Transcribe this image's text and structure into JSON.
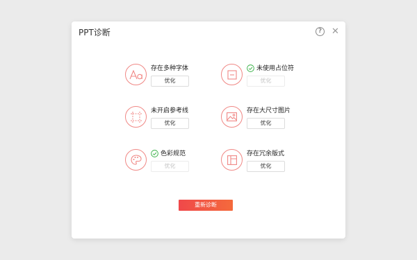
{
  "dialog": {
    "title": "PPT诊断",
    "help_symbol": "?",
    "close_symbol": "✕"
  },
  "items": [
    {
      "label": "存在多种字体",
      "button": "优化",
      "resolved": false,
      "icon": "font-icon"
    },
    {
      "label": "未使用占位符",
      "button": "优化",
      "resolved": true,
      "icon": "placeholder-icon"
    },
    {
      "label": "未开启参考线",
      "button": "优化",
      "resolved": false,
      "icon": "guides-icon"
    },
    {
      "label": "存在大尺寸图片",
      "button": "优化",
      "resolved": false,
      "icon": "image-icon"
    },
    {
      "label": "色彩规范",
      "button": "优化",
      "resolved": true,
      "icon": "palette-icon"
    },
    {
      "label": "存在冗余版式",
      "button": "优化",
      "resolved": false,
      "icon": "layout-icon"
    }
  ],
  "footer": {
    "rediagnose_label": "重新诊断"
  },
  "colors": {
    "accent": "#f08784",
    "check": "#3cb34a",
    "primary_button": "#f0484a",
    "disabled_text": "#c4c4c4"
  }
}
